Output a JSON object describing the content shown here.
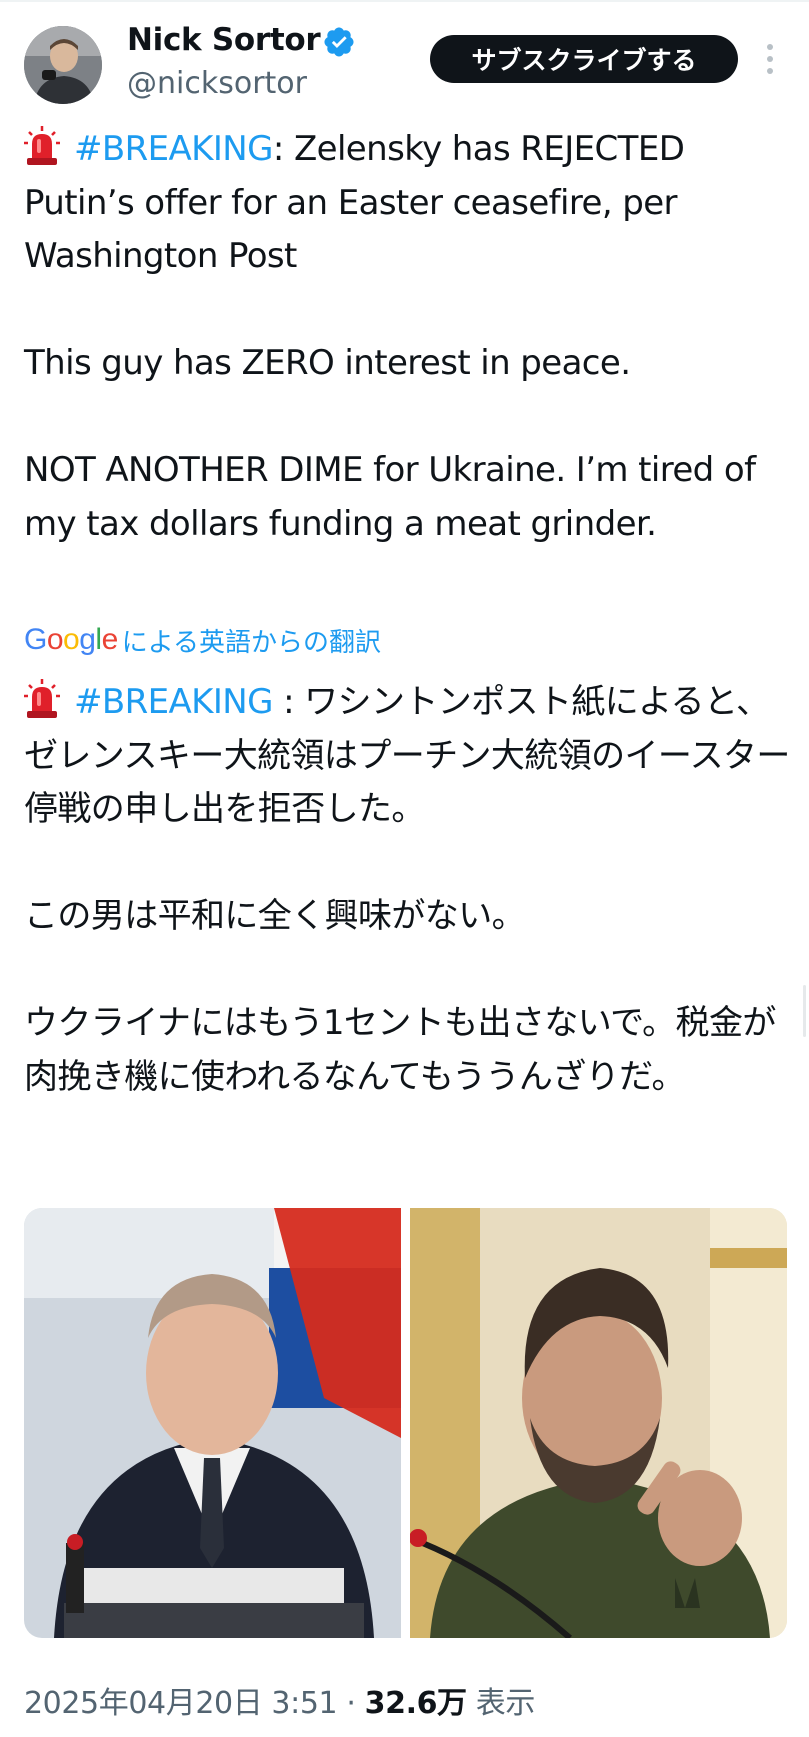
{
  "author": {
    "name": "Nick Sortor",
    "handle": "@nicksortor",
    "verified": true,
    "avatar": "avatar-photo"
  },
  "subscribe_label": "サブスクライブする",
  "more_icon": "more-vertical-icon",
  "tweet_en": {
    "hashtag": "#BREAKING",
    "line1_rest": ": Zelensky has REJECTED Putin’s offer for an Easter ceasefire, per Washington Post",
    "para2": "This guy has ZERO interest in peace.",
    "para3": "NOT ANOTHER DIME for Ukraine. I’m tired of my tax dollars funding a meat grinder."
  },
  "translation": {
    "google": [
      "G",
      "o",
      "o",
      "g",
      "l",
      "e"
    ],
    "label": "による英語からの翻訳"
  },
  "tweet_ja": {
    "hashtag": "#BREAKING",
    "line1_rest": " : ワシントンポスト紙によると、ゼレンスキー大統領はプーチン大統領のイースター停戦の申し出を拒否した。",
    "para2": "この男は平和に全く興味がない。",
    "para3": "ウクライナにはもう1セントも出さないで。税金が肉挽き機に使われるなんてもううんざりだ。"
  },
  "emoji": "rotating-light-icon",
  "media": [
    {
      "name": "putin-photo",
      "alt": "photo-left"
    },
    {
      "name": "zelensky-photo",
      "alt": "photo-right"
    }
  ],
  "meta": {
    "timestamp": "2025年04月20日 3:51",
    "separator": " · ",
    "views_count": "32.6万",
    "views_label": " 表示"
  },
  "colors": {
    "link": "#1d9bf0",
    "text": "#0f1419",
    "secondary": "#536471",
    "button_bg": "#0f1419"
  }
}
